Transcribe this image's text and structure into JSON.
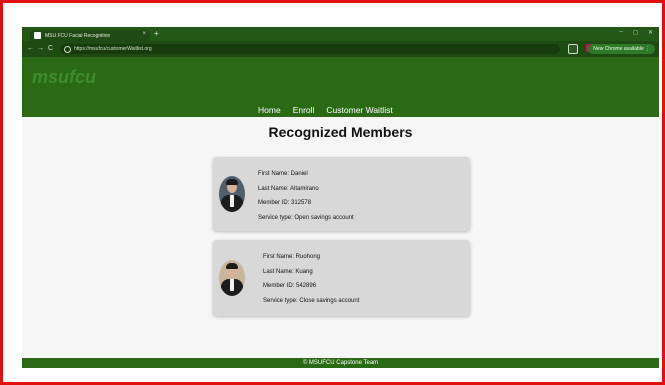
{
  "browser": {
    "tab_title": "MSU FCU Facial Recognition",
    "tab_close": "×",
    "new_tab": "+",
    "url": "https://msufcu/customerWaitlist.org",
    "update_badge": "New Chrome available ⋮",
    "nav_back": "←",
    "nav_forward": "→",
    "nav_reload": "C",
    "window_controls": [
      "–",
      "◻",
      "✕"
    ]
  },
  "site": {
    "logo": "msufcu",
    "nav": [
      "Home",
      "Enroll",
      "Customer Waitlist"
    ],
    "title": "Recognized Members",
    "footer": "© MSUFCU Capstone Team"
  },
  "members": [
    {
      "first_name": "First Name: Daniel",
      "last_name": "Last Name: Altamirano",
      "member_id": "Member ID: 312578",
      "service": "Service type: Open savings account"
    },
    {
      "first_name": "First Name: Ruohong",
      "last_name": "Last Name: Kuang",
      "member_id": "Member ID: 542896",
      "service": "Service type: Close savings account"
    }
  ],
  "colors": {
    "frame_border": "#e01010",
    "header_green": "#2a6a15",
    "card_bg": "#d8d8d8"
  }
}
